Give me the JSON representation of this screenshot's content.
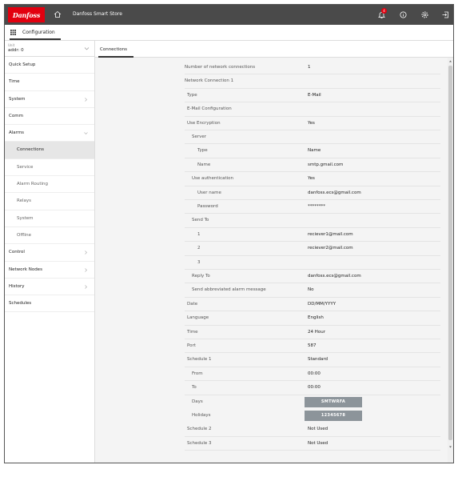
{
  "header": {
    "logo_text": "Danfoss",
    "app_title": "Danfoss Smart Store",
    "notification_count": "4",
    "brand_color": "#e2000f",
    "bar_color": "#4a4a4a",
    "icons": [
      "home-icon",
      "bell-icon",
      "info-icon",
      "gear-icon",
      "logout-icon"
    ]
  },
  "subbar": {
    "title": "Configuration",
    "icon": "grid-icon"
  },
  "sidebar": {
    "unit_label": "Unit",
    "unit_value": "addr: 0",
    "items": [
      {
        "label": "Quick Setup",
        "chevron": false,
        "sub": false,
        "active": false
      },
      {
        "label": "Time",
        "chevron": false,
        "sub": false,
        "active": false
      },
      {
        "label": "System",
        "chevron": true,
        "sub": false,
        "active": false
      },
      {
        "label": "Comm",
        "chevron": false,
        "sub": false,
        "active": false
      },
      {
        "label": "Alarms",
        "chevron": true,
        "expanded": true,
        "sub": false,
        "active": false
      },
      {
        "label": "Connections",
        "chevron": false,
        "sub": true,
        "active": true
      },
      {
        "label": "Service",
        "chevron": false,
        "sub": true,
        "active": false
      },
      {
        "label": "Alarm Routing",
        "chevron": false,
        "sub": true,
        "active": false
      },
      {
        "label": "Relays",
        "chevron": false,
        "sub": true,
        "active": false
      },
      {
        "label": "System",
        "chevron": false,
        "sub": true,
        "active": false
      },
      {
        "label": "Offline",
        "chevron": false,
        "sub": true,
        "active": false
      },
      {
        "label": "Control",
        "chevron": true,
        "sub": false,
        "active": false
      },
      {
        "label": "Network Nodes",
        "chevron": true,
        "sub": false,
        "active": false
      },
      {
        "label": "History",
        "chevron": true,
        "sub": false,
        "active": false
      },
      {
        "label": "Schedules",
        "chevron": false,
        "sub": false,
        "active": false
      }
    ]
  },
  "tab": {
    "label": "Connections"
  },
  "rows": [
    {
      "label": "Number of network connections",
      "value": "1",
      "indent": 0
    },
    {
      "label": "Network Connection 1",
      "value": "",
      "indent": 0
    },
    {
      "label": "Type",
      "value": "E-Mail",
      "indent": 1
    },
    {
      "label": "E-Mail Configuration",
      "value": "",
      "indent": 1
    },
    {
      "label": "Use Encryption",
      "value": "Yes",
      "indent": 1
    },
    {
      "label": "Server",
      "value": "",
      "indent": 2
    },
    {
      "label": "Type",
      "value": "Name",
      "indent": 3
    },
    {
      "label": "Name",
      "value": "smtp.gmail.com",
      "indent": 3
    },
    {
      "label": "Use authentication",
      "value": "Yes",
      "indent": 2
    },
    {
      "label": "User name",
      "value": "danfoss.ecs@gmail.com",
      "indent": 3
    },
    {
      "label": "Password",
      "value": "********",
      "indent": 3
    },
    {
      "label": "Send To",
      "value": "",
      "indent": 2
    },
    {
      "label": "1",
      "value": "reciever1@mail.com",
      "indent": 3
    },
    {
      "label": "2",
      "value": "reciever2@mail.com",
      "indent": 3
    },
    {
      "label": "3",
      "value": "",
      "indent": 3
    },
    {
      "label": "Reply To",
      "value": "danfoss.ecs@gmail.com",
      "indent": 2
    },
    {
      "label": "Send abbreviated alarm message",
      "value": "No",
      "indent": 2
    },
    {
      "label": "Date",
      "value": "DD/MM/YYYY",
      "indent": 1
    },
    {
      "label": "Language",
      "value": "English",
      "indent": 1
    },
    {
      "label": "Time",
      "value": "24 Hour",
      "indent": 1
    },
    {
      "label": "Port",
      "value": "587",
      "indent": 1
    },
    {
      "label": "Schedule 1",
      "value": "Standard",
      "indent": 1
    },
    {
      "label": "From",
      "value": "00:00",
      "indent": 2
    },
    {
      "label": "To",
      "value": "00:00",
      "indent": 2
    },
    {
      "label": "Days",
      "value": "SMTWRFA",
      "indent": 2,
      "button": true
    },
    {
      "label": "Holidays",
      "value": "12345678",
      "indent": 2,
      "button": true
    },
    {
      "label": "Schedule 2",
      "value": "Not Used",
      "indent": 1
    },
    {
      "label": "Schedule 3",
      "value": "Not Used",
      "indent": 1
    }
  ]
}
